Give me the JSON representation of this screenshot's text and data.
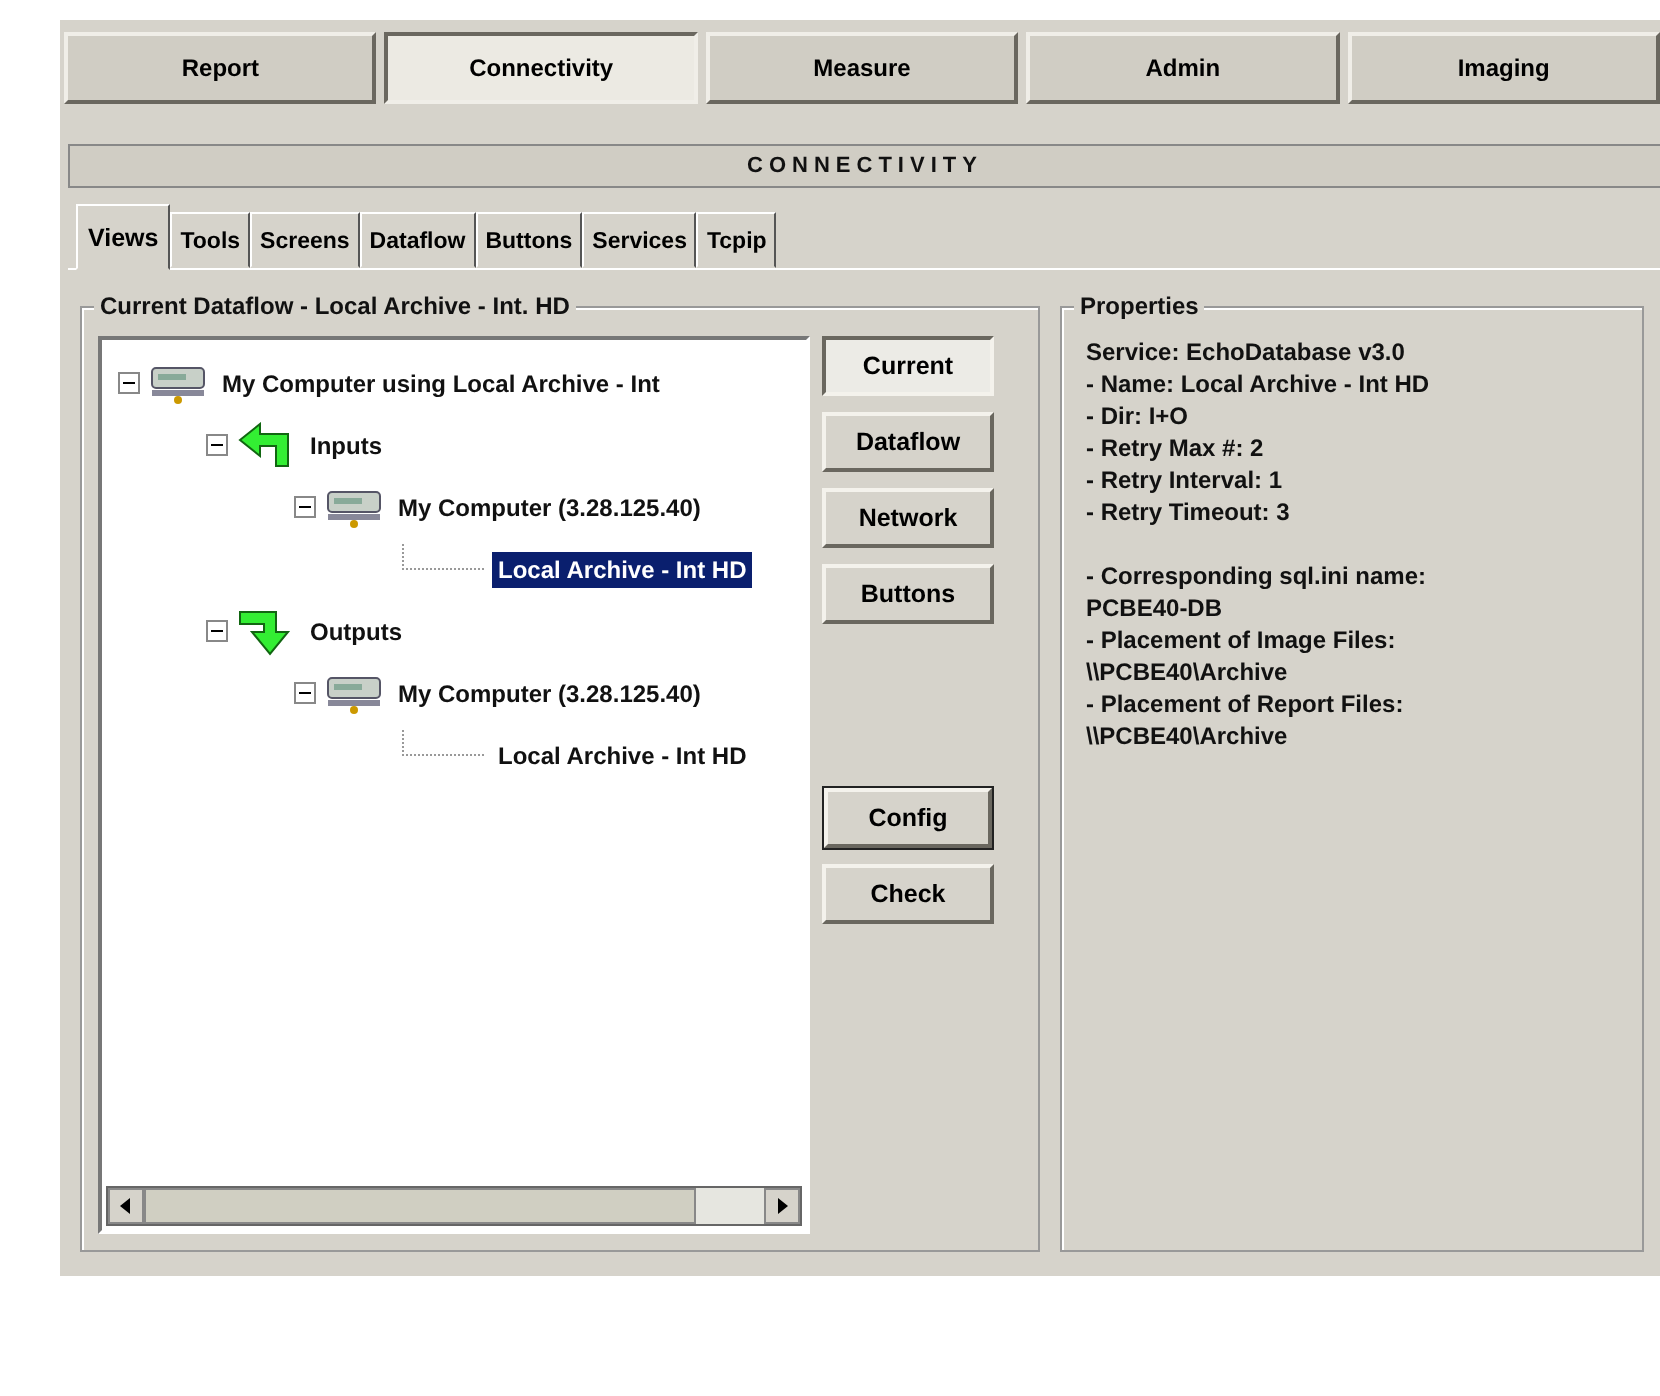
{
  "main_tabs": [
    {
      "label": "Report",
      "selected": false
    },
    {
      "label": "Connectivity",
      "selected": true
    },
    {
      "label": "Measure",
      "selected": false
    },
    {
      "label": "Admin",
      "selected": false
    },
    {
      "label": "Imaging",
      "selected": false
    }
  ],
  "section_title": "CONNECTIVITY",
  "sub_tabs": [
    {
      "label": "Views",
      "selected": true
    },
    {
      "label": "Tools",
      "selected": false
    },
    {
      "label": "Screens",
      "selected": false
    },
    {
      "label": "Dataflow",
      "selected": false
    },
    {
      "label": "Buttons",
      "selected": false
    },
    {
      "label": "Services",
      "selected": false
    },
    {
      "label": "Tcpip",
      "selected": false
    }
  ],
  "dataflow_group": {
    "title": "Current Dataflow - Local Archive - Int. HD",
    "tree": [
      {
        "label": "My Computer using Local Archive - Int",
        "kind": "computer",
        "expanded": true,
        "selected": false,
        "children": [
          {
            "label": "Inputs",
            "kind": "input",
            "expanded": true,
            "selected": false,
            "children": [
              {
                "label": "My Computer (3.28.125.40)",
                "kind": "computer",
                "expanded": true,
                "selected": false,
                "children": [
                  {
                    "label": "Local Archive - Int HD",
                    "kind": "leaf",
                    "selected": true
                  }
                ]
              }
            ]
          },
          {
            "label": "Outputs",
            "kind": "output",
            "expanded": true,
            "selected": false,
            "children": [
              {
                "label": "My Computer (3.28.125.40)",
                "kind": "computer",
                "expanded": true,
                "selected": false,
                "children": [
                  {
                    "label": "Local Archive - Int HD",
                    "kind": "leaf",
                    "selected": false
                  }
                ]
              }
            ]
          }
        ]
      }
    ],
    "view_buttons": [
      {
        "label": "Current",
        "selected": true
      },
      {
        "label": "Dataflow",
        "selected": false
      },
      {
        "label": "Network",
        "selected": false
      },
      {
        "label": "Buttons",
        "selected": false
      }
    ],
    "action_buttons": [
      {
        "label": "Config",
        "default": true
      },
      {
        "label": "Check",
        "default": false
      }
    ]
  },
  "properties": {
    "title": "Properties",
    "blocks": [
      [
        "Service: EchoDatabase v3.0",
        "- Name: Local Archive - Int HD",
        "- Dir: I+O",
        "- Retry Max #: 2",
        "- Retry Interval: 1",
        "- Retry Timeout: 3"
      ],
      [
        "- Corresponding sql.ini name:",
        "PCBE40-DB",
        "- Placement of Image Files:",
        "\\\\PCBE40\\Archive",
        "- Placement of Report Files:",
        "\\\\PCBE40\\Archive"
      ]
    ]
  }
}
